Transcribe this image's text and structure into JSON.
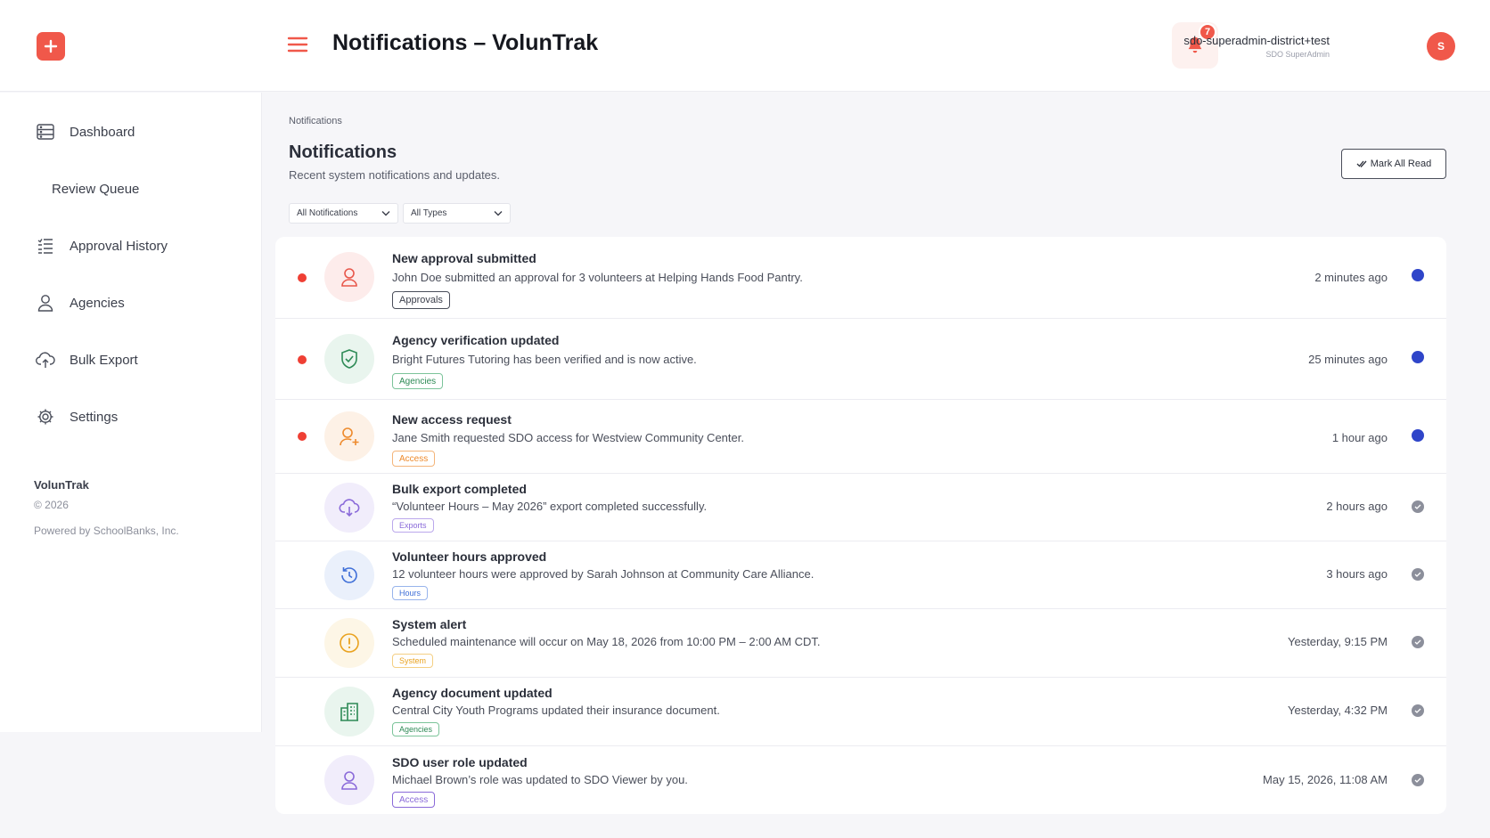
{
  "header": {
    "title": "Notifications – VolunTrak",
    "notification_count": "7",
    "user_name": "sdo-superadmin-district+test",
    "user_role": "SDO SuperAdmin",
    "avatar_initial": "S"
  },
  "sidebar": {
    "items": [
      {
        "label": "Dashboard",
        "icon": "dashboard-icon"
      },
      {
        "label": "Review Queue",
        "icon": ""
      },
      {
        "label": "Approval History",
        "icon": "history-list-icon"
      },
      {
        "label": "Agencies",
        "icon": "user-icon"
      },
      {
        "label": "Bulk Export",
        "icon": "cloud-upload-icon"
      },
      {
        "label": "Settings",
        "icon": "gear-icon"
      }
    ],
    "brand": "VolunTrak",
    "copyright": "© 2026",
    "powered_by": "Powered by SchoolBanks, Inc."
  },
  "main": {
    "breadcrumb": "Notifications",
    "title": "Notifications",
    "subtitle": "Recent system notifications and updates.",
    "mark_all_read": "Mark All Read",
    "filters": {
      "scope": "All Notifications",
      "type": "All Types"
    },
    "notifications": [
      {
        "title": "New approval submitted",
        "description": "John Doe submitted an approval for 3 volunteers at Helping Hands Food Pantry.",
        "tag": "Approvals",
        "time": "2 minutes ago",
        "unread": true,
        "icon": "user-icon"
      },
      {
        "title": "Agency verification updated",
        "description": "Bright Futures Tutoring has been verified and is now active.",
        "tag": "Agencies",
        "time": "25 minutes ago",
        "unread": true,
        "icon": "shield-check-icon"
      },
      {
        "title": "New access request",
        "description": "Jane Smith requested SDO access for Westview Community Center.",
        "tag": "Access",
        "time": "1 hour ago",
        "unread": true,
        "icon": "user-plus-icon"
      },
      {
        "title": "Bulk export completed",
        "description": "“Volunteer Hours – May 2026” export completed successfully.",
        "tag": "Exports",
        "time": "2 hours ago",
        "unread": false,
        "icon": "cloud-download-icon"
      },
      {
        "title": "Volunteer hours approved",
        "description": "12 volunteer hours were approved by Sarah Johnson at Community Care Alliance.",
        "tag": "Hours",
        "time": "3 hours ago",
        "unread": false,
        "icon": "history-icon"
      },
      {
        "title": "System alert",
        "description": "Scheduled maintenance will occur on May 18, 2026 from 10:00 PM – 2:00 AM CDT.",
        "tag": "System",
        "time": "Yesterday, 9:15 PM",
        "unread": false,
        "icon": "alert-circle-icon"
      },
      {
        "title": "Agency document updated",
        "description": "Central City Youth Programs updated their insurance document.",
        "tag": "Agencies",
        "time": "Yesterday, 4:32 PM",
        "unread": false,
        "icon": "building-icon"
      },
      {
        "title": "SDO user role updated",
        "description": "Michael Brown’s role was updated to SDO Viewer by you.",
        "tag": "Access",
        "time": "May 15, 2026, 11:08 AM",
        "unread": false,
        "icon": "user-icon"
      }
    ]
  },
  "colors": {
    "accent": "#f0584a",
    "unread_status": "#2f45c9",
    "read_status": "#8c8f9b"
  }
}
